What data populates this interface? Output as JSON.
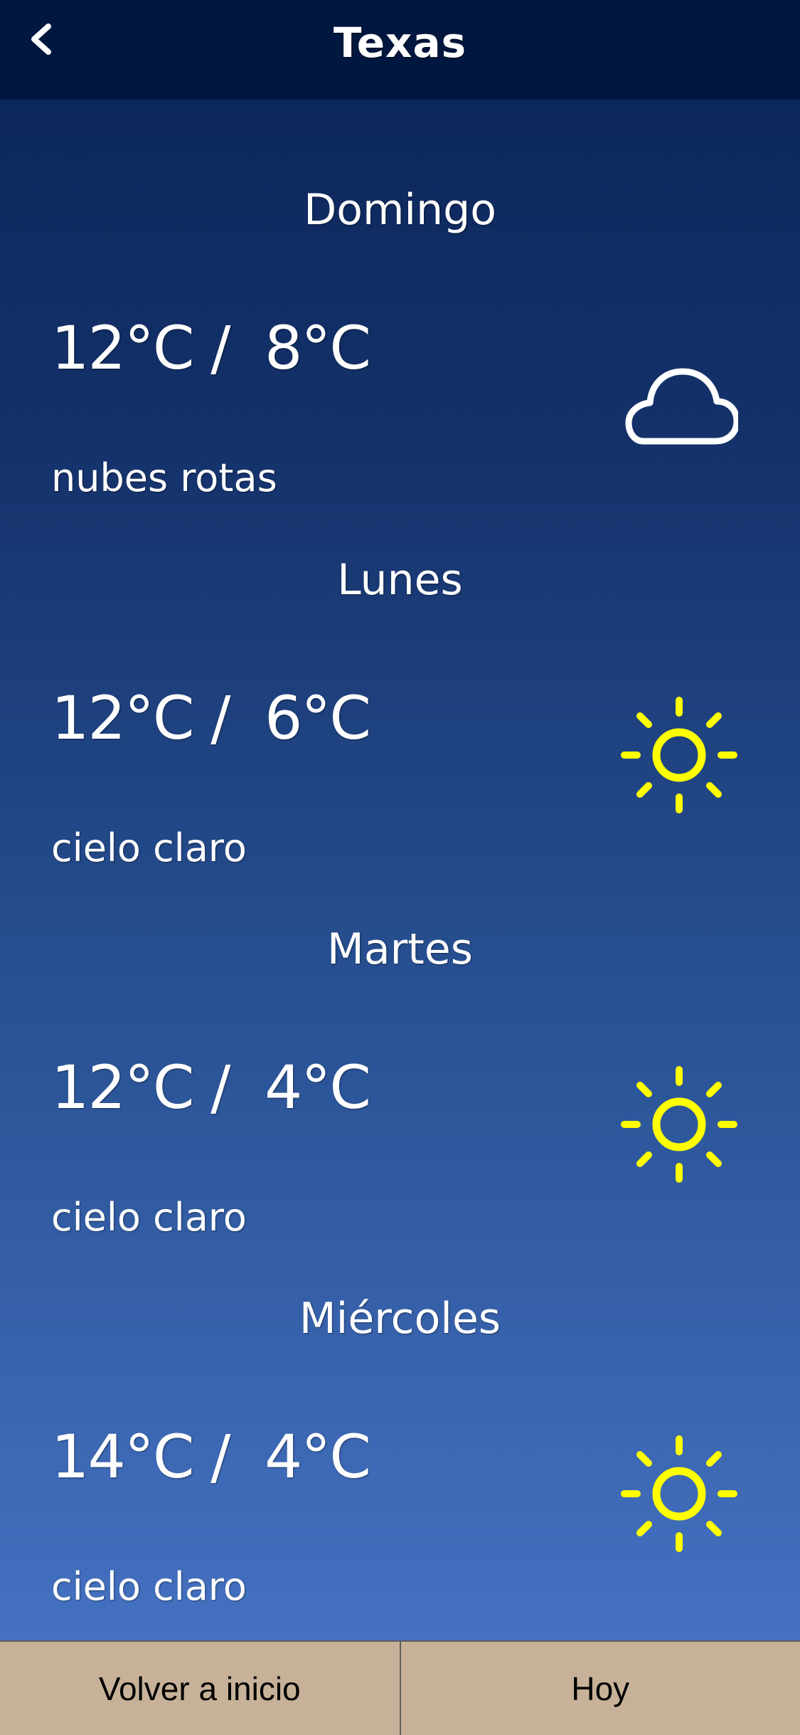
{
  "header": {
    "title": "Texas",
    "back_icon": "chevron-left-icon"
  },
  "days": [
    {
      "name": "Domingo",
      "temps": "12°C /  8°C",
      "description": "nubes rotas",
      "icon": "cloud-icon"
    },
    {
      "name": "Lunes",
      "temps": "12°C /  6°C",
      "description": "cielo claro",
      "icon": "sun-icon"
    },
    {
      "name": "Martes",
      "temps": "12°C /  4°C",
      "description": "cielo claro",
      "icon": "sun-icon"
    },
    {
      "name": "Miércoles",
      "temps": "14°C /  4°C",
      "description": "cielo claro",
      "icon": "sun-icon"
    }
  ],
  "footer": {
    "home_label": "Volver a inicio",
    "today_label": "Hoy"
  },
  "colors": {
    "header_bg": "#00173f",
    "sun": "#ffff00",
    "footer_bg": "#c7b299"
  }
}
